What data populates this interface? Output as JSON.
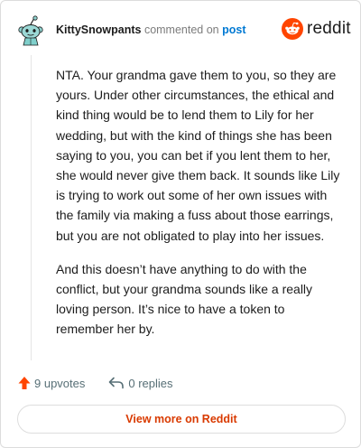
{
  "header": {
    "author": "KittySnowpants",
    "action_text": "commented on",
    "post_link": "post"
  },
  "brand": {
    "name": "reddit",
    "color": "#ff4500"
  },
  "comment": {
    "paragraphs": [
      "NTA. Your grandma gave them to you, so they are yours. Under other circumstances, the ethical and kind thing would be to lend them to Lily for her wedding, but with the kind of things she has been saying to you, you can bet if you lent them to her, she would never give them back. It sounds like Lily is trying to work out some of her own issues with the family via making a fuss about those earrings, but you are not obligated to play into her issues.",
      "And this doesn’t have anything to do with the conflict, but your grandma sounds like a really loving person. It’s nice to have a token to remember her by."
    ]
  },
  "actions": {
    "upvotes_label": "9 upvotes",
    "replies_label": "0 replies"
  },
  "view_more_label": "View more on Reddit",
  "colors": {
    "upvote": "#ff4500",
    "link": "#0079d3",
    "view_more": "#d93a00"
  }
}
